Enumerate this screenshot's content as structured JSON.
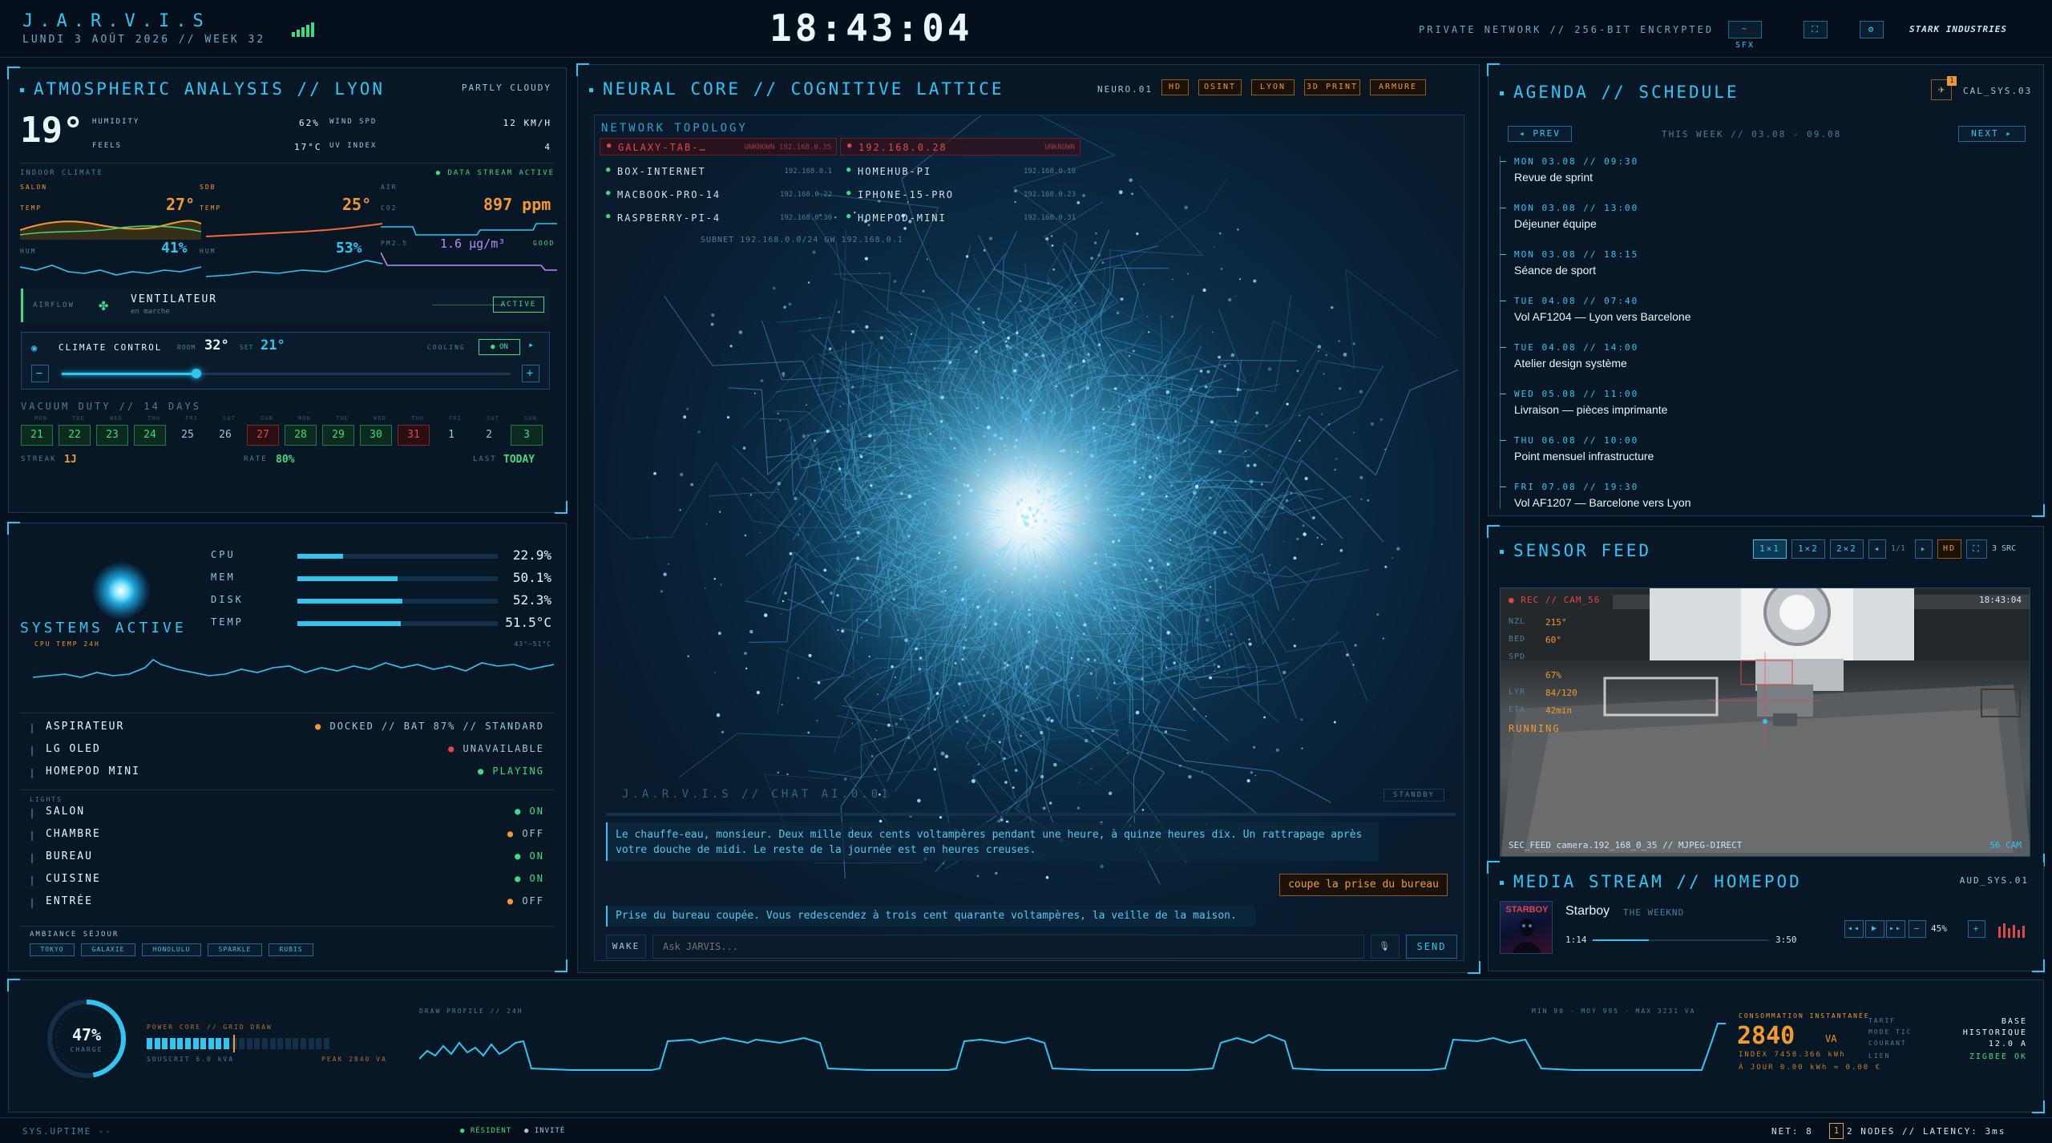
{
  "header": {
    "title": "J.A.R.V.I.S",
    "date": "LUNDI 3 AOÛT 2026 // WEEK 32",
    "clock": "18:43:04",
    "network": "PRIVATE NETWORK // 256-BIT ENCRYPTED",
    "sfx": "~ SFX",
    "brand": "STARK INDUSTRIES"
  },
  "weather": {
    "title": "ATMOSPHERIC ANALYSIS // LYON",
    "condition": "PARTLY CLOUDY",
    "temp": "19°",
    "humidity_label": "HUMIDITY",
    "humidity": "62%",
    "wind_label": "WIND SPD",
    "wind": "12 KM/H",
    "feels_label": "FEELS",
    "feels": "17°C",
    "uv_label": "UV INDEX",
    "uv": "4",
    "indoor_label": "INDOOR CLIMATE",
    "stream": "DATA STREAM ACTIVE",
    "salon_label": "SALON",
    "salon_temp_label": "TEMP",
    "salon_temp": "27°",
    "salon_hum_label": "HUM",
    "salon_hum": "41%",
    "sdb_label": "SDB",
    "sdb_temp_label": "TEMP",
    "sdb_temp": "25°",
    "sdb_hum_label": "HUM",
    "sdb_hum": "53%",
    "air_label": "AIR",
    "co2_label": "CO2",
    "co2": "897 ppm",
    "pm_label": "PM2.5",
    "pm": "1.6 µg/m³",
    "pm_quality": "GOOD"
  },
  "airflow": {
    "label": "AIRFLOW",
    "name": "VENTILATEUR",
    "state": "en marche",
    "badge": "ACTIVE"
  },
  "climate": {
    "label": "CLIMATE CONTROL",
    "room_label": "ROOM",
    "room": "32°",
    "set_label": "SET",
    "set": "21°",
    "mode": "COOLING",
    "toggle": "ON",
    "minus": "−",
    "plus": "+",
    "arrow": "▸",
    "level": 0.3
  },
  "vacuum": {
    "title": "VACUUM DUTY // 14 DAYS",
    "days": [
      {
        "d": "MON",
        "n": "21",
        "s": "ok"
      },
      {
        "d": "TUE",
        "n": "22",
        "s": "ok"
      },
      {
        "d": "WED",
        "n": "23",
        "s": "ok"
      },
      {
        "d": "THU",
        "n": "24",
        "s": "ok"
      },
      {
        "d": "FRI",
        "n": "25",
        "s": "none"
      },
      {
        "d": "SAT",
        "n": "26",
        "s": "none"
      },
      {
        "d": "SUN",
        "n": "27",
        "s": "miss"
      },
      {
        "d": "MON",
        "n": "28",
        "s": "ok"
      },
      {
        "d": "TUE",
        "n": "29",
        "s": "ok"
      },
      {
        "d": "WED",
        "n": "30",
        "s": "ok"
      },
      {
        "d": "THU",
        "n": "31",
        "s": "miss"
      },
      {
        "d": "FRI",
        "n": "1",
        "s": "none"
      },
      {
        "d": "SAT",
        "n": "2",
        "s": "none"
      },
      {
        "d": "SUN",
        "n": "3",
        "s": "ok"
      }
    ],
    "streak_label": "STREAK",
    "streak": "1J",
    "rate_label": "RATE",
    "rate": "80%",
    "last_label": "LAST",
    "last": "TODAY"
  },
  "systems": {
    "label": "SYSTEMS ACTIVE",
    "cpu_label": "CPU",
    "cpu": "22.9%",
    "cpu_level": 0.229,
    "mem_label": "MEM",
    "mem": "50.1%",
    "mem_level": 0.501,
    "disk_label": "DISK",
    "disk": "52.3%",
    "disk_level": 0.523,
    "temp_label": "TEMP",
    "temp": "51.5°C",
    "temp_level": 0.515,
    "graph_label": "CPU TEMP 24H",
    "graph_range": "43°–51°C"
  },
  "devices": [
    {
      "name": "ASPIRATEUR",
      "status": "DOCKED // BAT 87% // STANDARD",
      "color": "#f29a2e"
    },
    {
      "name": "LG OLED",
      "status": "UNAVAILABLE",
      "color": "#e04848"
    },
    {
      "name": "HOMEPOD MINI",
      "status": "PLAYING",
      "color": "#3ddc84"
    }
  ],
  "lights_label": "LIGHTS",
  "lights": [
    {
      "name": "SALON",
      "state": "ON",
      "color": "#3ddc84"
    },
    {
      "name": "CHAMBRE",
      "state": "OFF",
      "color": "#f29a2e"
    },
    {
      "name": "BUREAU",
      "state": "ON",
      "color": "#3ddc84"
    },
    {
      "name": "CUISINE",
      "state": "ON",
      "color": "#3ddc84"
    },
    {
      "name": "ENTRÉE",
      "state": "OFF",
      "color": "#f29a2e"
    }
  ],
  "ambiance": {
    "label": "AMBIANCE SÉJOUR",
    "items": [
      "TOKYO",
      "GALAXIE",
      "HONOLULU",
      "SPARKLE",
      "RUBIS"
    ]
  },
  "neural": {
    "title": "NEURAL CORE // COGNITIVE LATTICE",
    "neuro": "NEURO.01",
    "tags": [
      "HD",
      "OSINT",
      "LYON",
      "3D PRINT",
      "ARMURE"
    ],
    "topology_label": "NETWORK TOPOLOGY",
    "hosts": [
      {
        "name": "GALAXY-TAB-…",
        "ip": "UNKNOWN 192.168.0.35",
        "alert": true
      },
      {
        "name": "192.168.0.28",
        "ip": "UNKNOWN",
        "alert": true
      },
      {
        "name": "BOX-INTERNET",
        "ip": "192.168.0.1",
        "alert": false
      },
      {
        "name": "HOMEHUB-PI",
        "ip": "192.168.0.10",
        "alert": false
      },
      {
        "name": "MACBOOK-PRO-14",
        "ip": "192.168.0.22",
        "alert": false
      },
      {
        "name": "IPHONE-15-PRO",
        "ip": "192.168.0.23",
        "alert": false
      },
      {
        "name": "RASPBERRY-PI-4",
        "ip": "192.168.0.30",
        "alert": false
      },
      {
        "name": "HOMEPOD-MINI",
        "ip": "192.168.0.31",
        "alert": false
      }
    ],
    "subnet": "SUBNET 192.168.0.0/24 GW 192.168.0.1",
    "chat_title": "J.A.R.V.I.S // CHAT AI.0.01",
    "chat_state": "STANDBY",
    "msg1": "Le chauffe-eau, monsieur. Deux mille deux cents voltampères pendant une heure, à quinze heures dix. Un rattrapage après votre douche de midi. Le reste de la journée est en heures creuses.",
    "user_msg": "coupe la prise du bureau",
    "msg2": "Prise du bureau coupée. Vous redescendez à trois cent quarante voltampères, la veille de la maison.",
    "wake": "WAKE",
    "placeholder": "Ask JARVIS...",
    "send": "SEND"
  },
  "agenda": {
    "title": "AGENDA // SCHEDULE",
    "badge": "1",
    "cal": "CAL_SYS.03",
    "prev": "◂ PREV",
    "week": "THIS WEEK // 03.08 - 09.08",
    "next": "NEXT ▸",
    "events": [
      {
        "when": "MON 03.08 // 09:30",
        "what": "Revue de sprint"
      },
      {
        "when": "MON 03.08 // 13:00",
        "what": "Déjeuner équipe"
      },
      {
        "when": "MON 03.08 // 18:15",
        "what": "Séance de sport"
      },
      {
        "when": "TUE 04.08 // 07:40",
        "what": "Vol AF1204 — Lyon vers Barcelone"
      },
      {
        "when": "TUE 04.08 // 14:00",
        "what": "Atelier design système"
      },
      {
        "when": "WED 05.08 // 11:00",
        "what": "Livraison — pièces imprimante"
      },
      {
        "when": "THU 06.08 // 10:00",
        "what": "Point mensuel infrastructure"
      },
      {
        "when": "FRI 07.08 // 19:30",
        "what": "Vol AF1207 — Barcelone vers Lyon"
      }
    ]
  },
  "sensor": {
    "title": "SENSOR FEED",
    "layouts": [
      "1×1",
      "1×2",
      "2×2"
    ],
    "prev": "◂",
    "page": "1/1",
    "next": "▸",
    "hd": "HD",
    "expand": "⛶",
    "src": "3 SRC",
    "rec": "REC // CAM_56",
    "time": "18:43:04",
    "overlay": [
      {
        "k": "NZL",
        "v": "215°"
      },
      {
        "k": "BED",
        "v": "60°"
      },
      {
        "k": "SPD",
        "v": ""
      },
      {
        "k": "",
        "v": "67%"
      },
      {
        "k": "LYR",
        "v": "84/120"
      },
      {
        "k": "ETA",
        "v": "42min"
      }
    ],
    "running": "RUNNING",
    "feed": "SEC_FEED camera.192_168_0_35 // MJPEG-DIRECT",
    "cam": "56 CAM"
  },
  "media": {
    "title": "MEDIA STREAM // HOMEPOD",
    "aud": "AUD_SYS.01",
    "art": "STARBOY",
    "track": "Starboy",
    "artist": "THE WEEKND",
    "elapsed": "1:14",
    "duration": "3:50",
    "progress": 0.32,
    "volume": "45%",
    "prev": "◂◂",
    "play": "▶",
    "next": "▸▸",
    "minus": "−",
    "plus": "+"
  },
  "power": {
    "percent": "47%",
    "percent_level": 0.47,
    "charge": "CHARGE",
    "core_label": "POWER CORE // GRID DRAW",
    "subscript": "SOUSCRIT 6.0 kVA",
    "peak": "PEAK 2840 VA",
    "profile_label": "DRAW PROFILE // 24H",
    "stats": "MIN 90 · MOY 995 · MAX 3231 VA",
    "conso_label": "CONSOMMATION INSTANTANÉE",
    "value": "2840",
    "unit": "VA",
    "index": "INDEX 7458.366 kWh",
    "today": "À JOUR 0.00 kWh ≈ 0.00 €",
    "tarif_label": "TARIF",
    "tarif": "BASE",
    "mode_label": "MODE TIC",
    "mode": "HISTORIQUE",
    "courant_label": "COURANT",
    "courant": "12.0 A",
    "lien_label": "LIEN",
    "lien": "ZIGBEE OK"
  },
  "status": {
    "uptime": "SYS.UPTIME --",
    "resident": "RÉSIDENT",
    "invite": "INVITÉ",
    "net": "NET: 8",
    "alerts": "1",
    "nodes": "2 NODES // LATENCY: 3ms"
  },
  "colors": {
    "accent": "#2fc6f4",
    "ok": "#3ddc84",
    "warn": "#f29a2e",
    "alert": "#e04848",
    "bg": "#071220"
  }
}
